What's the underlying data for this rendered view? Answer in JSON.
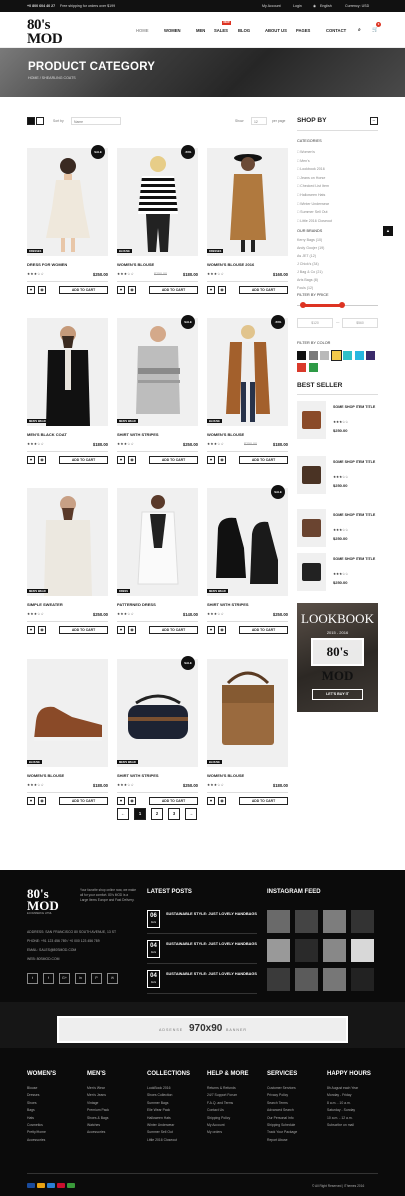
{
  "topbar": {
    "phone": "+0 800 604 40 27",
    "shipping": "Free shipping for orders over $199",
    "account": "My Account",
    "login": "Login",
    "language": "English",
    "currency": "Currency: USD"
  },
  "brand": {
    "logo_main": "80's MOD",
    "logo_sub": "ECOMMERCE HTML"
  },
  "nav": {
    "home": "HOME",
    "women": "WOMEN",
    "men": "MEN",
    "sales": "SALES",
    "new_badge": "NEW",
    "blog": "BLOG",
    "about": "ABOUT US",
    "pages": "PAGES",
    "contact": "CONTACT",
    "cart_count": "0"
  },
  "hero": {
    "title": "PRODUCT CATEGORY",
    "breadcrumb": "HOME / SHEARLING COATS"
  },
  "toolbar": {
    "sort_label": "Sort by",
    "sort_value": "Name",
    "show_label": "Show",
    "show_value": "12",
    "per_page": "per page"
  },
  "products": [
    {
      "name": "DRESS FOR WOMEN",
      "tag": "DRESSES",
      "badge": "SALE",
      "price": "$250.00",
      "old": "",
      "rating": "★★★☆☆"
    },
    {
      "name": "WOMEN'S BLOUSE",
      "tag": "BLOUSE",
      "badge": "-50%",
      "price": "$180.00",
      "old": "$250.00",
      "rating": "★★★☆☆"
    },
    {
      "name": "WOMEN'S BLOUSE 2016",
      "tag": "DRESSES",
      "badge": "",
      "price": "$160.00",
      "old": "",
      "rating": "★★★☆☆"
    },
    {
      "name": "MEN'S BLACK COAT",
      "tag": "MEN'S WEAR",
      "badge": "",
      "price": "$180.00",
      "old": "",
      "rating": "★★★☆☆"
    },
    {
      "name": "SHIRT WITH STRIPES",
      "tag": "MEN'S WEAR",
      "badge": "SALE",
      "price": "$250.00",
      "old": "",
      "rating": "★★★☆☆"
    },
    {
      "name": "WOMEN'S BLOUSE",
      "tag": "BLOUSE",
      "badge": "-50%",
      "price": "$180.00",
      "old": "$250.00",
      "rating": "★★★☆☆"
    },
    {
      "name": "SIMPLE SWEATER",
      "tag": "MEN'S WEAR",
      "badge": "",
      "price": "$250.00",
      "old": "",
      "rating": "★★★☆☆"
    },
    {
      "name": "PATTERNED DRESS",
      "tag": "DRESS",
      "badge": "",
      "price": "$140.00",
      "old": "",
      "rating": "★★★☆☆"
    },
    {
      "name": "SHIRT WITH STRIPES",
      "tag": "MEN'S WEAR",
      "badge": "SALE",
      "price": "$250.00",
      "old": "",
      "rating": "★★★☆☆"
    },
    {
      "name": "WOMEN'S BLOUSE",
      "tag": "BLOUSE",
      "badge": "",
      "price": "$180.00",
      "old": "",
      "rating": "★★★☆☆"
    },
    {
      "name": "SHIRT WITH STRIPES",
      "tag": "MEN'S WEAR",
      "badge": "SALE",
      "price": "$250.00",
      "old": "",
      "rating": "★★★☆☆"
    },
    {
      "name": "WOMEN'S BLOUSE",
      "tag": "BLOUSE",
      "badge": "",
      "price": "$180.00",
      "old": "",
      "rating": "★★★☆☆"
    }
  ],
  "add_to_cart": "ADD TO CART",
  "pagination": [
    "←",
    "1",
    "2",
    "3",
    "→"
  ],
  "sidebar": {
    "title": "SHOP BY",
    "categories_label": "CATEGORIES",
    "categories": [
      "Women's",
      "Men's",
      "Lookbook 2016",
      "Jeans on Horse",
      "Checked List Item",
      "Halloween Hats",
      "Winter Underwear",
      "Summer Sell Out",
      "Little 2016 Closeout"
    ],
    "brands_label": "OUR BRANDS",
    "brands": [
      "Kerry Bags (10)",
      "Andy Goojer (19)",
      "As JET (12)",
      "J Chick's (34)",
      "J Bag & Co (21)",
      "Arts Bags (8)",
      "Fouls (12)"
    ],
    "price_label": "FILTER BY PRICE",
    "price_min": "$120",
    "price_sep": "—",
    "price_max": "$560",
    "price_range_fraction": [
      0.08,
      0.56
    ],
    "color_label": "FILTER BY COLOR",
    "colors": [
      "#111111",
      "#7a7a7a",
      "#b9b9b9",
      "#f3c94b",
      "#2ec0c8",
      "#27b7e0",
      "#3b2b6b",
      "#d93a2b",
      "#2e9a46"
    ],
    "bestseller_title": "BEST SELLER",
    "bestsellers": [
      {
        "name": "SOME SHOP ITEM TITLE",
        "price": "$250.00",
        "rating": "★★★☆☆"
      },
      {
        "name": "SOME SHOP ITEM TITLE",
        "price": "$250.00",
        "rating": "★★★☆☆"
      },
      {
        "name": "SOME SHOP ITEM TITLE",
        "price": "$250.00",
        "rating": "★★★☆☆"
      },
      {
        "name": "SOME SHOP ITEM TITLE",
        "price": "$250.00",
        "rating": "★★★☆☆"
      }
    ],
    "lookbook": {
      "title": "LOOKBOOK",
      "years": "2015 - 2016",
      "logo": "80's MOD",
      "button": "LET'S BUY IT"
    }
  },
  "footer": {
    "about": "Your favorite shop online now, we make all for your comfort. 80's MOD is a Large Items Europe and Fast Delivery.",
    "address": "ADDRESS: SAN FRANCISCO 80 SOUTH AVENUE, 13 ST",
    "phone": "PHONE: +91 123 456 789 / +0 000 123 456 789",
    "email": "EMAIL: SALES@80SMOD.COM",
    "web": "WEB: 80SMOD.COM",
    "social": [
      "t",
      "f",
      "G+",
      "in",
      "P",
      "✉"
    ],
    "latest_title": "LATEST POSTS",
    "posts": [
      {
        "day": "06",
        "month": "AUG",
        "title": "SUSTAINABLE STYLE: JUST LOVELY HANDBAGS"
      },
      {
        "day": "04",
        "month": "AUG",
        "title": "SUSTAINABLE STYLE: JUST LOVELY HANDBAGS"
      },
      {
        "day": "04",
        "month": "AUG",
        "title": "SUSTAINABLE STYLE: JUST LOVELY HANDBAGS"
      }
    ],
    "instagram_title": "INSTAGRAM FEED",
    "adsense": "ADSENSE",
    "ad_size": "970x90",
    "ad_banner": "BANNER",
    "columns": [
      {
        "title": "WOMEN'S",
        "items": [
          "Blouse",
          "Dresses",
          "Shoes",
          "Bags",
          "Hats",
          "Cosmetics",
          "Pretty/Home",
          "Accessories"
        ]
      },
      {
        "title": "MEN'S",
        "items": [
          "Men's Wear",
          "Men's Jeans",
          "Vintage",
          "Premium Pack",
          "Shoes & Bags",
          "Watches",
          "Accessories"
        ]
      },
      {
        "title": "COLLECTIONS",
        "items": [
          "LookBook 2016",
          "Shoes Collection",
          "Summer Bags",
          "Elle Wear Pack",
          "Halloween Hats",
          "Winter Underwear",
          "Summer Sell Out",
          "Little 2016 Closeout"
        ]
      },
      {
        "title": "HELP & MORE",
        "items": [
          "Returns & Refunds",
          "24/7 Support Forum",
          "F.A.Q. and Terms",
          "Contact Us",
          "Shipping Policy",
          "My Account",
          "My orders"
        ]
      },
      {
        "title": "SERVICES",
        "items": [
          "Customer Services",
          "Privacy Policy",
          "Search Terms",
          "Advanced Search",
          "Our Personal Info",
          "Shipping Schedule",
          "Track Your Package",
          "Report Abuse"
        ]
      },
      {
        "title": "HAPPY HOURS",
        "items": [
          "8h August each Year",
          "Monday - Friday",
          "8 a.m. - 10 a.m.",
          "Saturday - Sunday",
          "10 a.m. - 12 a.m.",
          "Subscribe on mail"
        ]
      }
    ],
    "copyright": "© All Right Reserved | iThemes 2016",
    "payments": [
      "#1a4b9c",
      "#e8a213",
      "#2a7fd4",
      "#c8102e",
      "#3a9a3a"
    ]
  }
}
